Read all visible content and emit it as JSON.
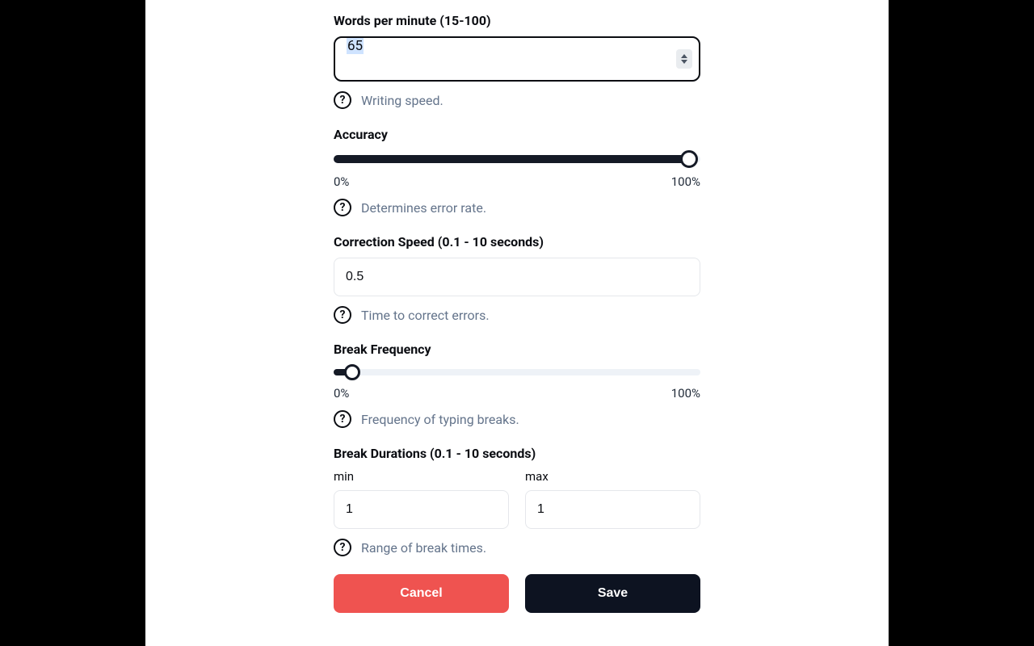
{
  "wpm": {
    "label": "Words per minute (15-100)",
    "value": "65",
    "help": "Writing speed."
  },
  "accuracy": {
    "label": "Accuracy",
    "min_label": "0%",
    "max_label": "100%",
    "percent": 97,
    "help": "Determines error rate."
  },
  "correction": {
    "label": "Correction Speed (0.1 - 10 seconds)",
    "value": "0.5",
    "help": "Time to correct errors."
  },
  "break_freq": {
    "label": "Break Frequency",
    "min_label": "0%",
    "max_label": "100%",
    "percent": 5,
    "help": "Frequency of typing breaks."
  },
  "break_dur": {
    "label": "Break Durations (0.1 - 10 seconds)",
    "min_label": "min",
    "max_label": "max",
    "min_value": "1",
    "max_value": "1",
    "help": "Range of break times."
  },
  "buttons": {
    "cancel": "Cancel",
    "save": "Save"
  }
}
